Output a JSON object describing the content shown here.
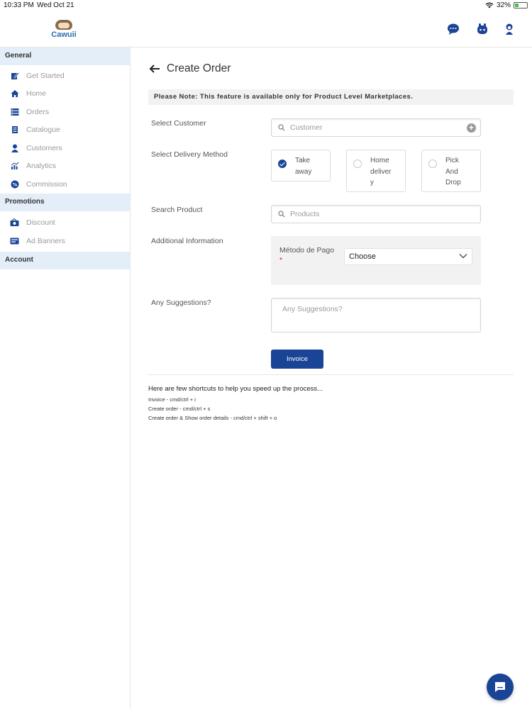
{
  "status": {
    "time": "10:33 PM",
    "date": "Wed Oct 21",
    "battery": "32%",
    "battery_level": 0.32
  },
  "header": {
    "logo_text": "Cawuii",
    "icons": [
      "support-chat-icon",
      "bot-icon",
      "user-profile-icon"
    ]
  },
  "sidebar": {
    "sections": [
      {
        "title": "General",
        "items": [
          {
            "label": "Get Started",
            "icon": "get-started-icon"
          },
          {
            "label": "Home",
            "icon": "home-icon"
          },
          {
            "label": "Orders",
            "icon": "orders-icon"
          },
          {
            "label": "Catalogue",
            "icon": "catalogue-icon"
          },
          {
            "label": "Customers",
            "icon": "customers-icon"
          },
          {
            "label": "Analytics",
            "icon": "analytics-icon"
          },
          {
            "label": "Commission",
            "icon": "commission-icon"
          }
        ]
      },
      {
        "title": "Promotions",
        "items": [
          {
            "label": "Discount",
            "icon": "discount-icon"
          },
          {
            "label": "Ad Banners",
            "icon": "ad-banners-icon"
          }
        ]
      },
      {
        "title": "Account",
        "items": []
      }
    ]
  },
  "main": {
    "title": "Create Order",
    "note": "Please Note: This feature is available only for Product Level Marketplaces.",
    "select_customer": {
      "label": "Select Customer",
      "placeholder": "Customer"
    },
    "delivery": {
      "label": "Select Delivery Method",
      "options": [
        {
          "line1": "Take",
          "line2": "away",
          "line3": "",
          "selected": true
        },
        {
          "line1": "Home",
          "line2": "deliver",
          "line3": "y",
          "selected": false
        },
        {
          "line1": "Pick",
          "line2": "And",
          "line3": "Drop",
          "selected": false
        }
      ]
    },
    "search_product": {
      "label": "Search Product",
      "placeholder": "Products"
    },
    "additional": {
      "label": "Additional Information",
      "field_label": "Método de Pago",
      "required_mark": "*",
      "select_value": "Choose"
    },
    "suggestions": {
      "label": "Any Suggestions?",
      "placeholder": "Any Suggestions?"
    },
    "invoice_button": "Invoice",
    "shortcuts": {
      "intro": "Here are few shortcuts to help you speed up the process...",
      "lines": [
        "Invoice - cmd/ctrl + i",
        "Create order - cmd/ctrl + s",
        "Create order & Show order details - cmd/ctrl + shift + o"
      ]
    }
  },
  "colors": {
    "primary": "#1a4496",
    "sidebar_section_bg": "#e3eef8",
    "note_bg": "#f2f2f2",
    "battery_fill": "#3bc04a"
  }
}
